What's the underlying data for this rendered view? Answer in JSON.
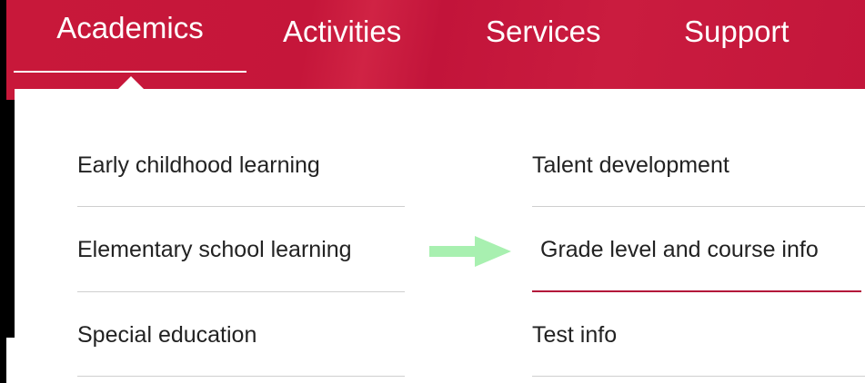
{
  "nav": {
    "items": [
      {
        "label": "Academics",
        "active": true
      },
      {
        "label": "Activities",
        "active": false
      },
      {
        "label": "Services",
        "active": false
      },
      {
        "label": "Support",
        "active": false
      }
    ]
  },
  "dropdown": {
    "left_column": [
      {
        "label": "Early childhood learning"
      },
      {
        "label": "Elementary school learning"
      },
      {
        "label": "Special education"
      }
    ],
    "right_column": [
      {
        "label": "Talent development"
      },
      {
        "label": "Grade level and course info",
        "hovered": true
      },
      {
        "label": "Test info"
      }
    ]
  },
  "annotation": {
    "arrow_icon": "right-arrow-icon",
    "arrow_color": "#a8f0b0"
  },
  "colors": {
    "brand": "#c8183a",
    "accent_underline": "#b3123a",
    "panel_background": "#ffffff"
  }
}
